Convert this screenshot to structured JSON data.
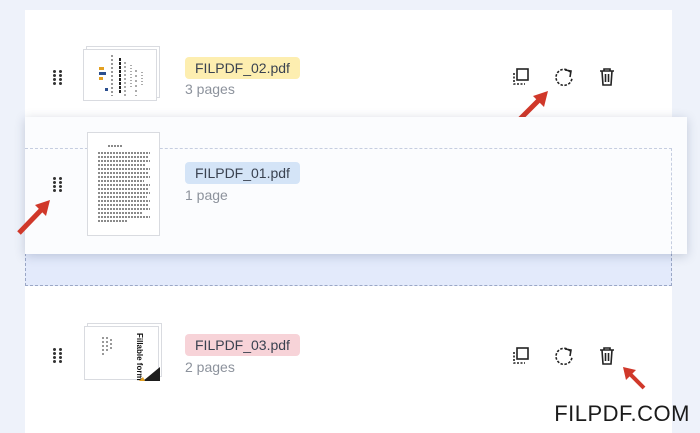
{
  "files": [
    {
      "name": "FILPDF_02.pdf",
      "pages": "3 pages",
      "badge_color": "#fdeeb0"
    },
    {
      "name": "FILPDF_01.pdf",
      "pages": "1 page",
      "badge_color": "#d4e4f7"
    },
    {
      "name": "FILPDF_03.pdf",
      "pages": "2 pages",
      "badge_color": "#f7d3d8"
    }
  ],
  "thumb_text": {
    "form_title": "Fillable form PDF"
  },
  "icons": {
    "drag": "drag-handle-icon",
    "duplicate": "duplicate-icon",
    "rotate": "rotate-icon",
    "delete": "trash-icon",
    "pointer": "red-arrow-icon"
  },
  "colors": {
    "accent_arrow": "#d0382a",
    "drop_zone": "#e3eafb"
  },
  "watermark": "FILPDF.COM"
}
